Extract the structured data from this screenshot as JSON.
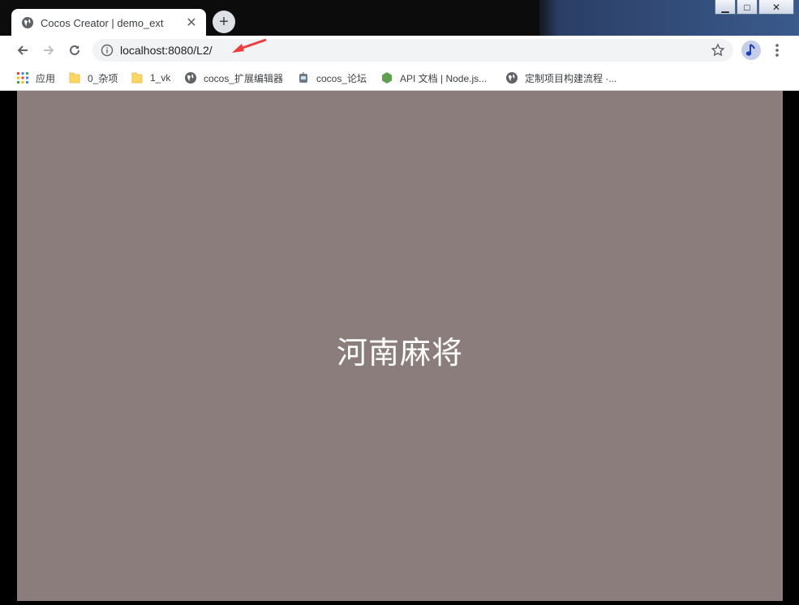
{
  "window": {
    "minimize_glyph": "▁",
    "maximize_glyph": "□",
    "close_glyph": "✕"
  },
  "tab": {
    "title": "Cocos Creator | demo_ext",
    "close_glyph": "✕",
    "new_tab_glyph": "+"
  },
  "toolbar": {
    "url": "localhost:8080/L2/"
  },
  "bookmarks": [
    {
      "label": "应用",
      "icon": "apps-grid-icon"
    },
    {
      "label": "0_杂项",
      "icon": "folder-icon"
    },
    {
      "label": "1_vk",
      "icon": "folder-icon"
    },
    {
      "label": "cocos_扩展编辑器",
      "icon": "globe-icon"
    },
    {
      "label": "cocos_论坛",
      "icon": "robot-icon"
    },
    {
      "label": "API 文档 | Node.js...",
      "icon": "nodejs-icon"
    },
    {
      "label": "定制项目构建流程 ·...",
      "icon": "globe-icon"
    }
  ],
  "game": {
    "title": "河南麻将",
    "background_color": "#8b7d7b"
  },
  "colors": {
    "annotation_arrow": "#f03c3c"
  }
}
